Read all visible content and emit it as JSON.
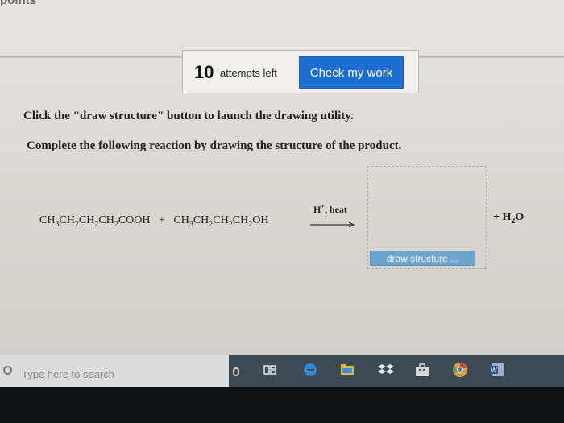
{
  "page": {
    "top_label": "points"
  },
  "toolbar": {
    "attempts_number": "10",
    "attempts_text": "attempts left",
    "check_button_label": "Check my work"
  },
  "instructions": {
    "line1": "Click the \"draw structure\" button to launch the drawing utility.",
    "line2": "Complete the following reaction by drawing the structure of the product."
  },
  "reaction": {
    "reactant1": "CH3CH2CH2CH2COOH",
    "plus": "+",
    "reactant2": "CH3CH2CH2CH2OH",
    "conditions_reagent": "H",
    "conditions_charge": "+",
    "conditions_text": ", heat",
    "byproduct_plus": "+",
    "byproduct": "H2O"
  },
  "drawing": {
    "draw_button_label": "draw structure ..."
  },
  "taskbar": {
    "search_placeholder": "Type here to search",
    "icons": [
      "microphone-icon",
      "task-view-icon",
      "edge-icon",
      "file-explorer-icon",
      "dropbox-icon",
      "store-icon",
      "chrome-icon",
      "word-icon"
    ]
  },
  "colors": {
    "check_button": "#1c6fd0",
    "draw_button": "#6da5cf",
    "taskbar": "#3d4a55"
  }
}
